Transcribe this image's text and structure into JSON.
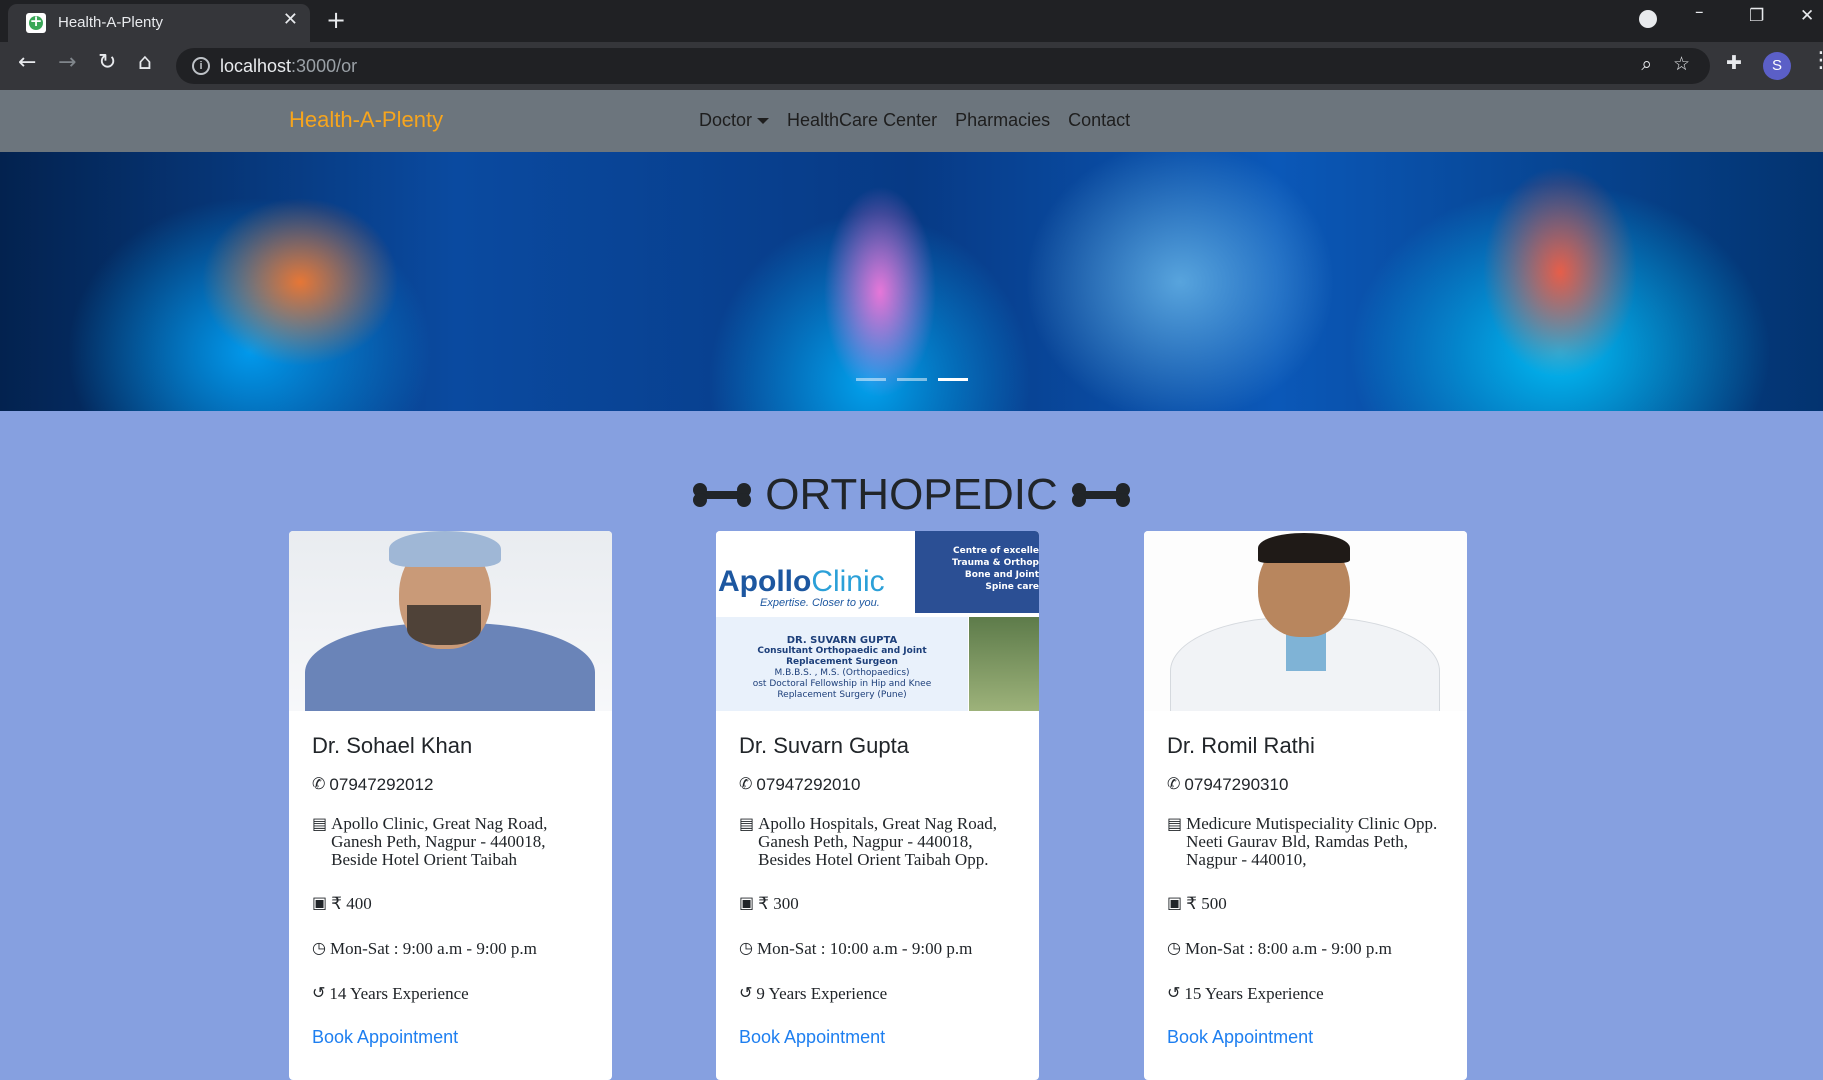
{
  "browser": {
    "tab_title": "Health-A-Plenty",
    "url_host": "localhost",
    "url_path": ":3000/or",
    "profile_initial": "S"
  },
  "navbar": {
    "brand": "Health-A-Plenty",
    "links": [
      {
        "label": "Doctor"
      },
      {
        "label": "HealthCare Center"
      },
      {
        "label": "Pharmacies"
      },
      {
        "label": "Contact"
      }
    ]
  },
  "section": {
    "title": "ORTHOPEDIC"
  },
  "carousel": {
    "slide_count": 3,
    "active_slide": 3
  },
  "doctors": [
    {
      "name": "Dr. Sohael Khan",
      "phone": "07947292012",
      "address": "Apollo Clinic, Great Nag Road, Ganesh Peth, Nagpur - 440018, Beside Hotel Orient Taibah",
      "fee": "₹ 400",
      "hours": "Mon-Sat : 9:00 a.m - 9:00 p.m",
      "experience": "14 Years Experience",
      "cta": "Book Appointment"
    },
    {
      "name": "Dr. Suvarn Gupta",
      "phone": "07947292010",
      "address": "Apollo Hospitals, Great Nag Road, Ganesh Peth, Nagpur - 440018, Besides Hotel Orient Taibah Opp.",
      "fee": "₹ 300",
      "hours": "Mon-Sat : 10:00 a.m - 9:00 p.m",
      "experience": "9 Years Experience",
      "cta": "Book Appointment",
      "image_text": {
        "banner_lines": [
          "Centre of excelle",
          "Trauma & Orthop",
          "Bone and Joint",
          "Spine care"
        ],
        "logo_main": "Apollo",
        "logo_sub": "Clinic",
        "tagline": "Expertise. Closer to you.",
        "card_lines": [
          "DR. SUVARN GUPTA",
          "Consultant Orthopaedic and Joint",
          "Replacement Surgeon",
          "M.B.B.S. , M.S. (Orthopaedics)",
          "ost Doctoral Fellowship in Hip and Knee",
          "Replacement Surgery (Pune)"
        ]
      }
    },
    {
      "name": "Dr. Romil Rathi",
      "phone": "07947290310",
      "address": "Medicure Mutispeciality Clinic Opp. Neeti Gaurav Bld, Ramdas Peth, Nagpur - 440010,",
      "fee": "₹ 500",
      "hours": "Mon-Sat : 8:00 a.m - 9:00 p.m",
      "experience": "15 Years Experience",
      "cta": "Book Appointment"
    }
  ],
  "colors": {
    "page_bg": "#86a0e0",
    "navbar_bg": "#6c757d",
    "brand": "#f7a51d",
    "link": "#1e7ff0"
  }
}
